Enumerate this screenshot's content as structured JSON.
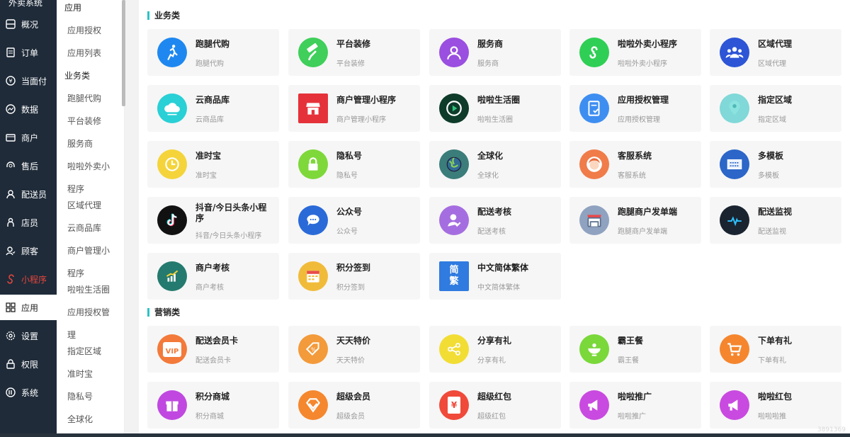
{
  "nav": {
    "brand": "外卖系统",
    "items": [
      {
        "label": "概况",
        "icon": "dashboard-icon"
      },
      {
        "label": "订单",
        "icon": "order-icon"
      },
      {
        "label": "当面付",
        "icon": "yen-icon"
      },
      {
        "label": "数据",
        "icon": "chart-icon"
      },
      {
        "label": "商户",
        "icon": "store-icon"
      },
      {
        "label": "售后",
        "icon": "headset-icon"
      },
      {
        "label": "配送员",
        "icon": "courier-icon"
      },
      {
        "label": "店员",
        "icon": "clerk-icon"
      },
      {
        "label": "顾客",
        "icon": "customer-icon"
      },
      {
        "label": "小程序",
        "icon": "miniprogram-icon"
      },
      {
        "label": "应用",
        "icon": "apps-icon"
      },
      {
        "label": "设置",
        "icon": "gear-icon"
      },
      {
        "label": "权限",
        "icon": "lock-icon"
      },
      {
        "label": "系统",
        "icon": "system-icon"
      }
    ]
  },
  "sub": {
    "items": [
      "应用",
      "应用授权",
      "应用列表",
      "业务类",
      "跑腿代购",
      "平台装修",
      "服务商",
      "啦啦外卖小",
      "程序",
      "区域代理",
      "云商品库",
      "商户管理小",
      "程序",
      "啦啦生活圈",
      "应用授权管",
      "理",
      "指定区域",
      "准时宝",
      "隐私号",
      "全球化"
    ]
  },
  "main": {
    "business": {
      "title": "业务类",
      "cards": [
        {
          "title": "跑腿代购",
          "sub": "跑腿代购",
          "icon": "runner-icon",
          "color": "#1e88f0"
        },
        {
          "title": "平台装修",
          "sub": "平台装修",
          "icon": "paint-roller-icon",
          "color": "#3fcf5a"
        },
        {
          "title": "服务商",
          "sub": "服务商",
          "icon": "person-icon",
          "color": "#9a4fe0"
        },
        {
          "title": "啦啦外卖小程序",
          "sub": "啦啦外卖小程序",
          "icon": "miniprogram-logo-icon",
          "color": "#2fcf55"
        },
        {
          "title": "区域代理",
          "sub": "区域代理",
          "icon": "group-icon",
          "color": "#2d55d6"
        },
        {
          "title": "云商品库",
          "sub": "云商品库",
          "icon": "cloud-icon",
          "color": "#29d0d6"
        },
        {
          "title": "商户管理小程序",
          "sub": "商户管理小程序",
          "icon": "shop-icon",
          "color": "#e5323a"
        },
        {
          "title": "啦啦生活圈",
          "sub": "啦啦生活圈",
          "icon": "play-circle-icon",
          "color": "#0e3b2a"
        },
        {
          "title": "应用授权管理",
          "sub": "应用授权管理",
          "icon": "authorize-doc-icon",
          "color": "#3e8ef1"
        },
        {
          "title": "指定区域",
          "sub": "指定区域",
          "icon": "location-pin-icon",
          "color": "#80d8d8"
        },
        {
          "title": "准时宝",
          "sub": "准时宝",
          "icon": "clock-icon",
          "color": "#f4d43a"
        },
        {
          "title": "隐私号",
          "sub": "隐私号",
          "icon": "padlock-icon",
          "color": "#7ed83a"
        },
        {
          "title": "全球化",
          "sub": "全球化",
          "icon": "globe-icon",
          "color": "#3a7d7a"
        },
        {
          "title": "客服系统",
          "sub": "客服系统",
          "icon": "service-avatar-icon",
          "color": "#f07c4a"
        },
        {
          "title": "多模板",
          "sub": "多模板",
          "icon": "template-board-icon",
          "color": "#2b66c8"
        },
        {
          "title": "抖音/今日头条小程序",
          "sub": "抖音/今日头条小程序",
          "icon": "douyin-icon",
          "color": "#111111"
        },
        {
          "title": "公众号",
          "sub": "公众号",
          "icon": "chat-bubble-icon",
          "color": "#2a6ad8"
        },
        {
          "title": "配送考核",
          "sub": "配送考核",
          "icon": "courier-check-icon",
          "color": "#a56ee0"
        },
        {
          "title": "跑腿商户发单端",
          "sub": "跑腿商户发单端",
          "icon": "storefront-icon",
          "color": "#8fa2c0"
        },
        {
          "title": "配送监视",
          "sub": "配送监视",
          "icon": "monitor-pulse-icon",
          "color": "#1a2430"
        },
        {
          "title": "商户考核",
          "sub": "商户考核",
          "icon": "growth-chart-icon",
          "color": "#247a6e"
        },
        {
          "title": "积分签到",
          "sub": "积分签到",
          "icon": "calendar-icon",
          "color": "#f1bb3a"
        },
        {
          "title": "中文简体繁体",
          "sub": "中文简体繁体",
          "icon": "simplified-traditional-icon",
          "color": "#2f7be0",
          "glyph1": "简",
          "glyph2": "繁"
        }
      ]
    },
    "marketing": {
      "title": "营销类",
      "cards": [
        {
          "title": "配送会员卡",
          "sub": "配送会员卡",
          "icon": "vip-card-icon",
          "color": "#f37a3a",
          "glyph1": "VIP"
        },
        {
          "title": "天天特价",
          "sub": "天天特价",
          "icon": "discount-tag-icon",
          "color": "#f39a3a"
        },
        {
          "title": "分享有礼",
          "sub": "分享有礼",
          "icon": "share-icon",
          "color": "#f2dd35"
        },
        {
          "title": "霸王餐",
          "sub": "霸王餐",
          "icon": "meal-icon",
          "color": "#7ad83a"
        },
        {
          "title": "下单有礼",
          "sub": "下单有礼",
          "icon": "cart-icon",
          "color": "#f5862e"
        },
        {
          "title": "积分商城",
          "sub": "积分商城",
          "icon": "gift-icon",
          "color": "#c048e0"
        },
        {
          "title": "超级会员",
          "sub": "超级会员",
          "icon": "diamond-icon",
          "color": "#f5872e"
        },
        {
          "title": "超级红包",
          "sub": "超级红包",
          "icon": "red-packet-icon",
          "color": "#f04a3a",
          "glyph1": "¥"
        },
        {
          "title": "啦啦推广",
          "sub": "啦啦推广",
          "icon": "megaphone-icon",
          "color": "#c94ae0"
        },
        {
          "title": "啦啦红包",
          "sub": "啦啦啦推",
          "icon": "megaphone-icon",
          "color": "#c94ae0"
        }
      ]
    }
  },
  "watermark": "3891369"
}
